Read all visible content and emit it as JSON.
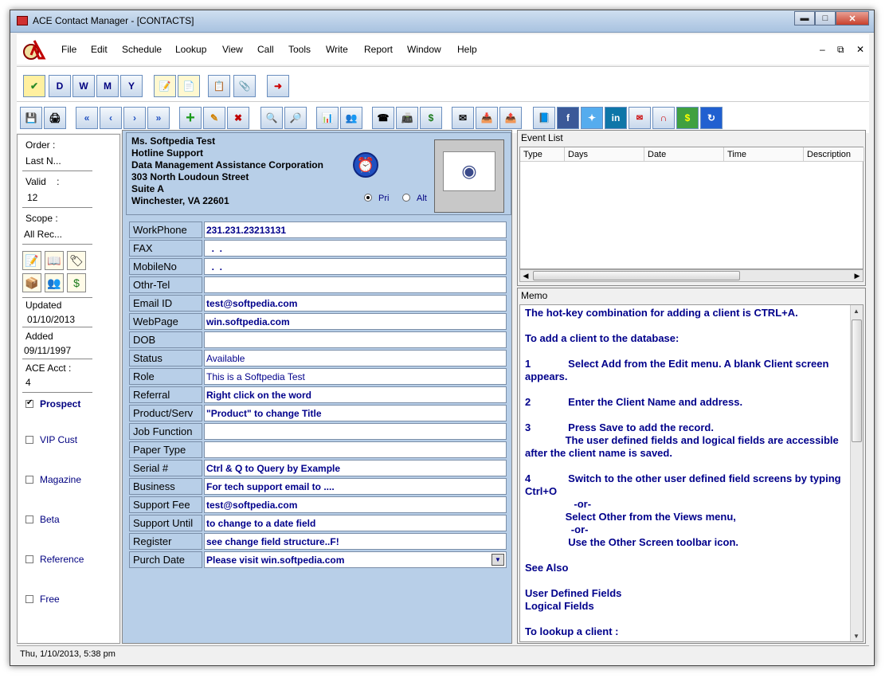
{
  "window": {
    "title": "ACE Contact Manager - [CONTACTS]"
  },
  "menu": {
    "items": [
      "File",
      "Edit",
      "Schedule",
      "Lookup",
      "View",
      "Call",
      "Tools",
      "Write",
      "Report",
      "Window",
      "Help"
    ]
  },
  "toolbar1": {
    "icons": [
      "checkmark-icon",
      "calendar-day-icon",
      "calendar-week-icon",
      "calendar-month-icon",
      "calendar-year-icon",
      "notepad-icon",
      "notes-icon",
      "copy-icon",
      "attach-icon",
      "exit-icon"
    ],
    "calendar_letters": [
      "D",
      "W",
      "M",
      "Y"
    ]
  },
  "toolbar2": {
    "icons": [
      "save-icon",
      "print-icon",
      "first-icon",
      "previous-icon",
      "next-icon",
      "last-icon",
      "add-icon",
      "edit-icon",
      "delete-icon",
      "binoculars-icon",
      "query-icon",
      "report-icon",
      "contacts-icon",
      "phone-icon",
      "fax-icon",
      "dollar-icon",
      "mail-icon",
      "inbox-icon",
      "outbox-icon",
      "book-icon",
      "facebook-icon",
      "twitter-icon",
      "linkedin-icon",
      "gmail-icon",
      "magnet-icon",
      "money-icon",
      "refresh-icon"
    ],
    "labels": {
      "facebook": "f",
      "linkedin": "in",
      "dollar": "$"
    }
  },
  "left": {
    "order_label": "Order :",
    "order_value": "Last N...",
    "valid_label": "Valid    :",
    "valid_value": "12",
    "scope_label": "Scope :",
    "scope_value": "All Rec...",
    "updated_label": "Updated",
    "updated_value": "01/10/2013",
    "added_label": "Added",
    "added_value": "09/11/1997",
    "acct_label": "ACE Acct :",
    "acct_value": "4",
    "checks": [
      {
        "label": "Prospect",
        "checked": true
      },
      {
        "label": "VIP Cust",
        "checked": false
      },
      {
        "label": "Magazine",
        "checked": false
      },
      {
        "label": "Beta",
        "checked": false
      },
      {
        "label": "Reference",
        "checked": false
      },
      {
        "label": "Free",
        "checked": false
      }
    ]
  },
  "address": {
    "lines": [
      "Ms. Softpedia Test",
      "Hotline Support",
      "Data Management Assistance Corporation",
      "303 North Loudoun Street",
      "Suite A",
      "Winchester, VA 22601"
    ],
    "radio_pri": "Pri",
    "radio_alt": "Alt",
    "selected": "Pri"
  },
  "fields": [
    {
      "label": "WorkPhone",
      "value": "231.231.23213131",
      "bold": true
    },
    {
      "label": "FAX",
      "value": "  .  .",
      "bold": true
    },
    {
      "label": "MobileNo",
      "value": "  .  .",
      "bold": true
    },
    {
      "label": "Othr-Tel",
      "value": "",
      "bold": true
    },
    {
      "label": "Email ID",
      "value": "test@softpedia.com",
      "bold": true
    },
    {
      "label": "WebPage",
      "value": "win.softpedia.com",
      "bold": true
    },
    {
      "label": "DOB",
      "value": "",
      "bold": true
    },
    {
      "label": "Status",
      "value": "Available",
      "bold": false
    },
    {
      "label": "Role",
      "value": "This is a Softpedia Test",
      "bold": false
    },
    {
      "label": "Referral",
      "value": "Right click on the word",
      "bold": true
    },
    {
      "label": "Product/Serv",
      "value": "\"Product\" to change Title",
      "bold": true
    },
    {
      "label": "Job Function",
      "value": "",
      "bold": true
    },
    {
      "label": "Paper Type",
      "value": "",
      "bold": true
    },
    {
      "label": "Serial #",
      "value": "Ctrl & Q to Query by Example",
      "bold": true
    },
    {
      "label": "Business",
      "value": "For tech support email to ....",
      "bold": true
    },
    {
      "label": "Support Fee",
      "value": "test@softpedia.com",
      "bold": true
    },
    {
      "label": "Support Until",
      "value": "to change to a date field",
      "bold": true
    },
    {
      "label": "Register",
      "value": "see change field structure..F!",
      "bold": true
    },
    {
      "label": "Purch Date",
      "value": "Please visit win.softpedia.com",
      "bold": true
    }
  ],
  "events": {
    "title": "Event List",
    "columns": [
      "Type",
      "Days",
      "Date",
      "Time",
      "Description"
    ]
  },
  "memo": {
    "title": "Memo",
    "text": "The hot-key combination for adding a client is CTRL+A.\n\nTo add a client to the database:\n\n1             Select Add from the Edit menu. A blank Client screen appears.\n\n2             Enter the Client Name and address.\n\n3             Press Save to add the record.\n              The user defined fields and logical fields are accessible after the client name is saved.\n\n4             Switch to the other user defined field screens by typing Ctrl+O\n                 -or-\n              Select Other from the Views menu,\n                -or-\n               Use the Other Screen toolbar icon.\n\nSee Also\n\nUser Defined Fields\nLogical Fields\n\nTo lookup a client :"
  },
  "status": {
    "text": "Thu, 1/10/2013, 5:38 pm"
  },
  "colors": {
    "panel": "#b8cfe8",
    "text_value": "#00008b"
  }
}
